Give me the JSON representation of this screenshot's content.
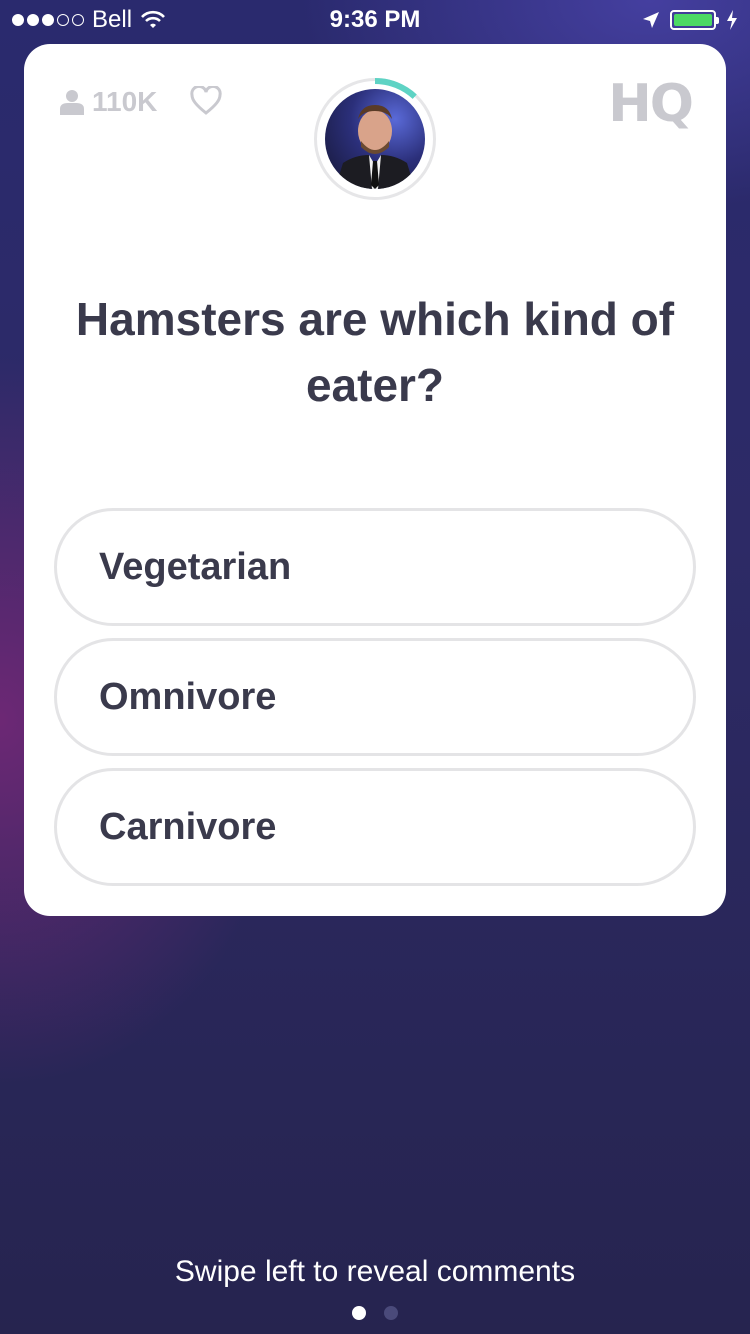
{
  "status_bar": {
    "carrier": "Bell",
    "time": "9:36 PM",
    "signal_filled": 3,
    "signal_total": 5,
    "battery_color": "#4cd964"
  },
  "header": {
    "viewer_count": "110K",
    "logo_text": "HQ",
    "icons": [
      "person-icon",
      "heart-icon",
      "hq-logo"
    ]
  },
  "timer": {
    "remaining_fraction": 0.12,
    "ring_color": "#5ed3c4"
  },
  "question": {
    "text": "Hamsters are which kind of eater?"
  },
  "answers": [
    {
      "label": "Vegetarian"
    },
    {
      "label": "Omnivore"
    },
    {
      "label": "Carnivore"
    }
  ],
  "footer": {
    "hint": "Swipe left to reveal comments",
    "page_count": 2,
    "active_page": 1
  },
  "colors": {
    "card_bg": "#ffffff",
    "text_dark": "#3a3a4c",
    "muted": "#c9c9cf"
  }
}
